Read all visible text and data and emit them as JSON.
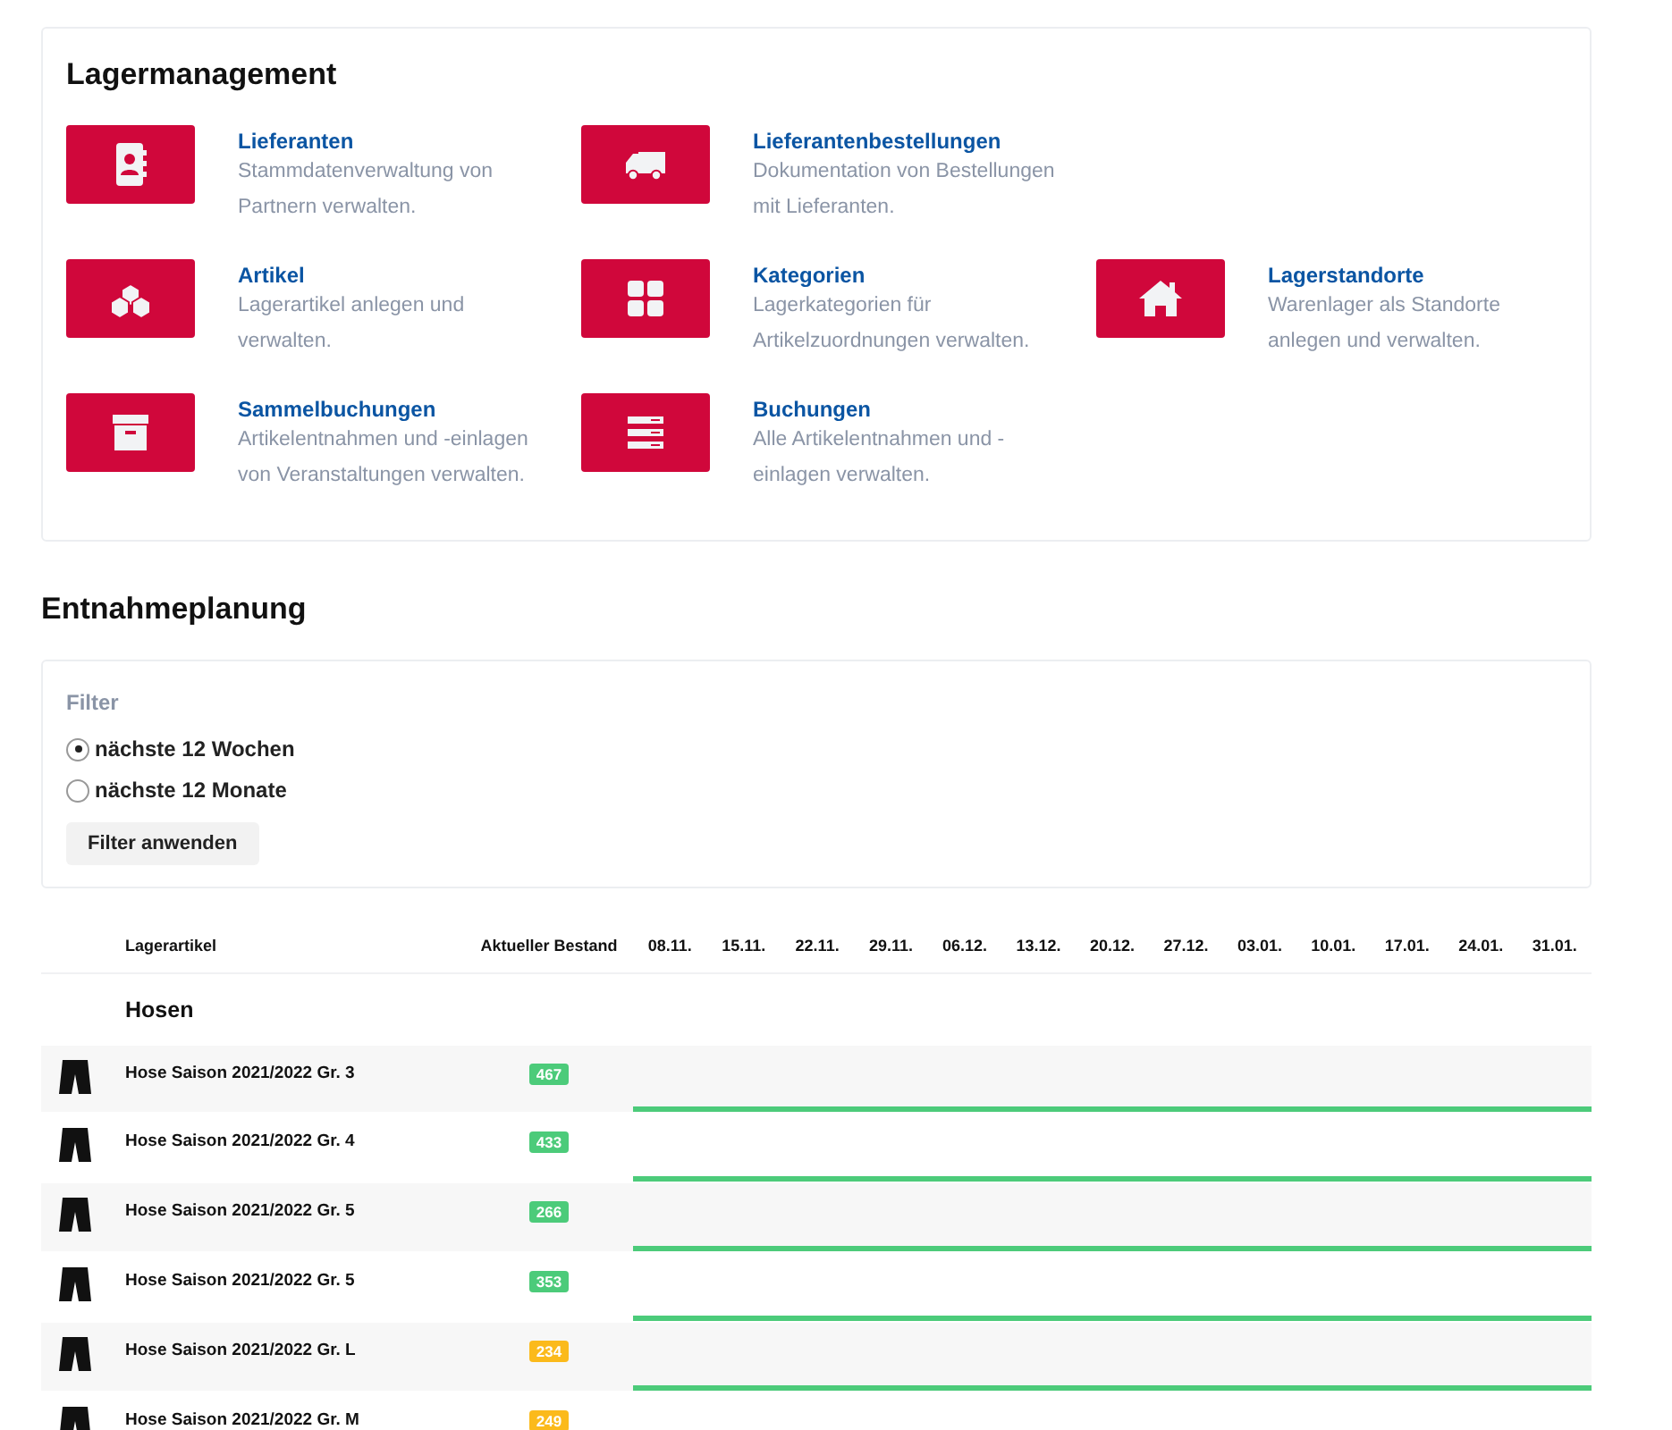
{
  "management": {
    "title": "Lagermanagement",
    "tile_rows": [
      [
        {
          "kind": "contacts",
          "title": "Lieferanten",
          "description": "Stammdatenverwaltung von Partnern verwalten."
        },
        {
          "kind": "truck",
          "title": "Lieferantenbestellungen",
          "description": "Dokumentation von Bestellungen mit Lieferanten."
        }
      ],
      [
        {
          "kind": "cubes",
          "title": "Artikel",
          "description": "Lagerartikel anlegen und verwalten."
        },
        {
          "kind": "grid",
          "title": "Kategorien",
          "description": "Lagerkategorien für Artikelzuordnungen verwalten."
        },
        {
          "kind": "house",
          "title": "Lagerstandorte",
          "description": "Warenlager als Standorte anlegen und verwalten."
        }
      ],
      [
        {
          "kind": "archive",
          "title": "Sammelbuchungen",
          "description": "Artikelentnahmen und -einlagen von Veranstaltungen verwalten."
        },
        {
          "kind": "list",
          "title": "Buchungen",
          "description": "Alle Artikelentnahmen und -einlagen verwalten."
        }
      ]
    ]
  },
  "planning": {
    "title": "Entnahmeplanung",
    "filter": {
      "label": "Filter",
      "options": [
        {
          "label": "nächste 12 Wochen",
          "selected": true
        },
        {
          "label": "nächste 12 Monate",
          "selected": false
        }
      ],
      "button": "Filter anwenden"
    },
    "table": {
      "columns": [
        "Lagerartikel",
        "Aktueller Bestand"
      ],
      "dates": [
        "08.11.",
        "15.11.",
        "22.11.",
        "29.11.",
        "06.12.",
        "13.12.",
        "20.12.",
        "27.12.",
        "03.01.",
        "10.01.",
        "17.01.",
        "24.01.",
        "31.01."
      ],
      "group": "Hosen",
      "rows": [
        {
          "name": "Hose Saison 2021/2022 Gr. 3",
          "stock": "467",
          "color": "#4ccb7a"
        },
        {
          "name": "Hose Saison 2021/2022 Gr. 4",
          "stock": "433",
          "color": "#4ccb7a"
        },
        {
          "name": "Hose Saison 2021/2022 Gr. 5",
          "stock": "266",
          "color": "#4ccb7a"
        },
        {
          "name": "Hose Saison 2021/2022 Gr. 5",
          "stock": "353",
          "color": "#4ccb7a"
        },
        {
          "name": "Hose Saison 2021/2022 Gr. L",
          "stock": "234",
          "color": "#fbba1b"
        },
        {
          "name": "Hose Saison 2021/2022 Gr. M",
          "stock": "249",
          "color": "#fbba1b"
        }
      ]
    }
  }
}
